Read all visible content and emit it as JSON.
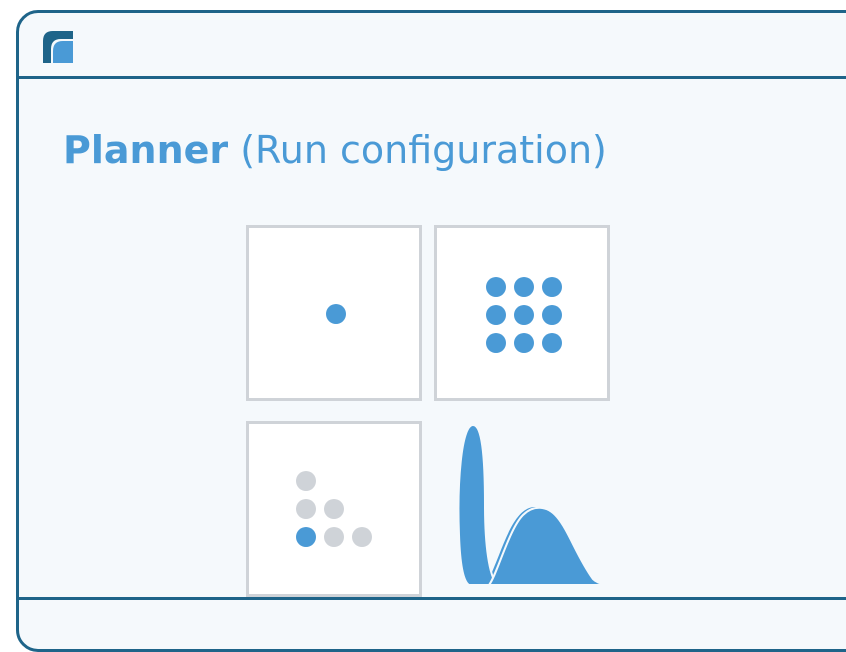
{
  "header": {
    "logo_icon": "brand-logo-icon"
  },
  "title": {
    "strong": "Planner",
    "rest": " (Run configuration)"
  },
  "illustration": {
    "tiles": [
      {
        "name": "single-point",
        "icon": "single-dot-icon"
      },
      {
        "name": "grid-points",
        "icon": "dot-grid-icon",
        "rows": 3,
        "cols": 3
      },
      {
        "name": "adaptive-points",
        "icon": "staircase-dots-icon"
      },
      {
        "name": "distributions",
        "icon": "distribution-curves-icon"
      }
    ]
  },
  "colors": {
    "border": "#1e6489",
    "accent": "#4a9ad6",
    "muted_dot": "#cfd3d8",
    "card_bg": "#f5f9fc"
  }
}
